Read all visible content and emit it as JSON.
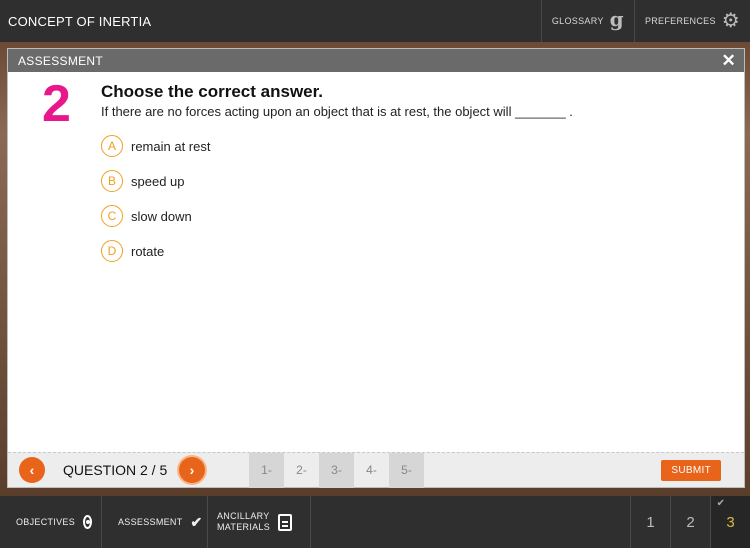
{
  "app": {
    "title": "CONCEPT OF INERTIA"
  },
  "topbar": {
    "glossary_label": "GLOSSARY",
    "glossary_icon": "glossary-g-icon",
    "preferences_label": "PREFERENCES",
    "preferences_icon": "gear-icon"
  },
  "modal": {
    "title": "ASSESSMENT",
    "close_symbol": "✕",
    "question_number": "2",
    "heading": "Choose the correct answer.",
    "question_text": "If there are no forces acting upon an object that is at rest, the object will _______ .",
    "options": [
      {
        "letter": "A",
        "text": "remain at rest"
      },
      {
        "letter": "B",
        "text": "speed up"
      },
      {
        "letter": "C",
        "text": "slow down"
      },
      {
        "letter": "D",
        "text": "rotate"
      }
    ],
    "footer": {
      "prev_symbol": "‹",
      "next_symbol": "›",
      "counter": "QUESTION 2 / 5",
      "tabs": [
        "1-",
        "2-",
        "3-",
        "4-",
        "5-"
      ],
      "submit_label": "SUBMIT"
    },
    "accent_color": "#e8641a",
    "number_color": "#e8188c",
    "option_color": "#f0a020"
  },
  "bottombar": {
    "objectives_label": "OBJECTIVES",
    "assessment_label": "ASSESSMENT",
    "ancillary_line1": "ANCILLARY",
    "ancillary_line2": "MATERIALS",
    "pages": [
      "1",
      "2",
      "3"
    ],
    "page_check": "✔"
  }
}
